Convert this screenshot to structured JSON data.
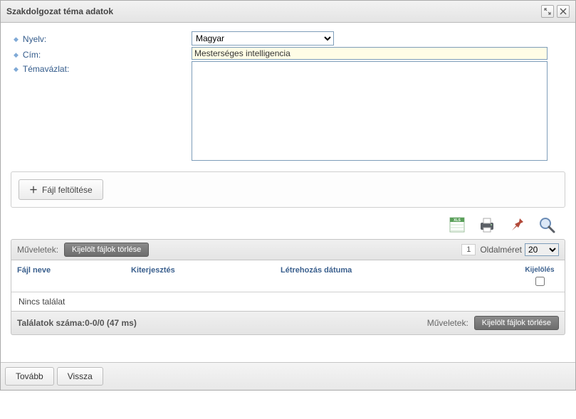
{
  "title": "Szakdolgozat téma adatok",
  "labels": {
    "lang": "Nyelv:",
    "title": "Cím:",
    "outline": "Témavázlat:"
  },
  "lang": {
    "selected": "Magyar"
  },
  "title_value": "Mesterséges intelligencia",
  "outline_value": "",
  "upload_btn": "Fájl feltöltése",
  "ops_label": "Műveletek:",
  "delete_btn": "Kijelölt fájlok törlése",
  "page_num": "1",
  "pagesize_label": "Oldalméret",
  "pagesize_value": "20",
  "columns": {
    "name": "Fájl neve",
    "ext": "Kiterjesztés",
    "date": "Létrehozás dátuma",
    "sel": "Kijelölés"
  },
  "no_results": "Nincs találat",
  "count_text": "Találatok száma:0-0/0 (47 ms)",
  "footer_ops_label": "Műveletek:",
  "footer_delete_btn": "Kijelölt fájlok törlése",
  "btn_next": "Tovább",
  "btn_back": "Vissza"
}
